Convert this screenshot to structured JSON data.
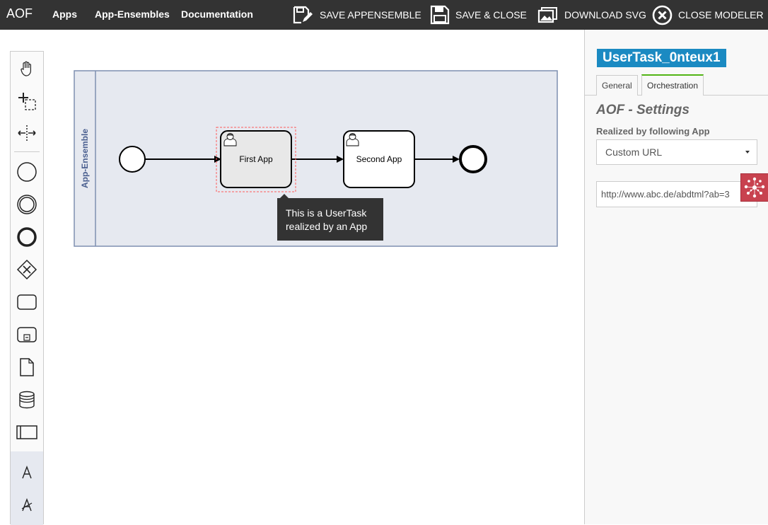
{
  "nav": {
    "brand": "AOF",
    "links": [
      "Apps",
      "App-Ensembles",
      "Documentation"
    ],
    "actions": [
      {
        "label": "SAVE APPENSEMBLE",
        "icon": "save-edit-icon"
      },
      {
        "label": "SAVE & CLOSE",
        "icon": "floppy-disk-icon"
      },
      {
        "label": "DOWNLOAD SVG",
        "icon": "image-download-icon"
      },
      {
        "label": "CLOSE MODELER",
        "icon": "close-circle-icon"
      }
    ]
  },
  "palette": {
    "tools": [
      "hand-tool-icon",
      "lasso-tool-icon",
      "space-tool-icon",
      "start-event-icon",
      "intermediate-event-icon",
      "end-event-icon",
      "gateway-icon",
      "task-icon",
      "subprocess-icon",
      "data-object-icon",
      "data-store-icon",
      "participant-icon",
      "text-annotation-icon",
      "text-tool-icon"
    ]
  },
  "diagram": {
    "pool_label": "App-Ensemble",
    "tasks": [
      {
        "label": "First App",
        "selected": true
      },
      {
        "label": "Second App",
        "selected": false
      }
    ],
    "tooltip": [
      "This is a UserTask",
      "realized by an App"
    ]
  },
  "properties": {
    "element_id": "UserTask_0nteux1",
    "tabs": [
      "General",
      "Orchestration"
    ],
    "active_tab": "Orchestration",
    "group_title": "AOF - Settings",
    "field_label": "Realized by following App",
    "select_value": "Custom URL",
    "url_value": "http://www.abc.de/abdtml?ab=3"
  },
  "colors": {
    "topbar": "#333333",
    "id_badge": "#1b8ac2",
    "active_tab": "#52b415",
    "pool_fill": "#e6e9f0",
    "pool_stroke": "#7f8fb0",
    "share_button": "#c8424f"
  }
}
